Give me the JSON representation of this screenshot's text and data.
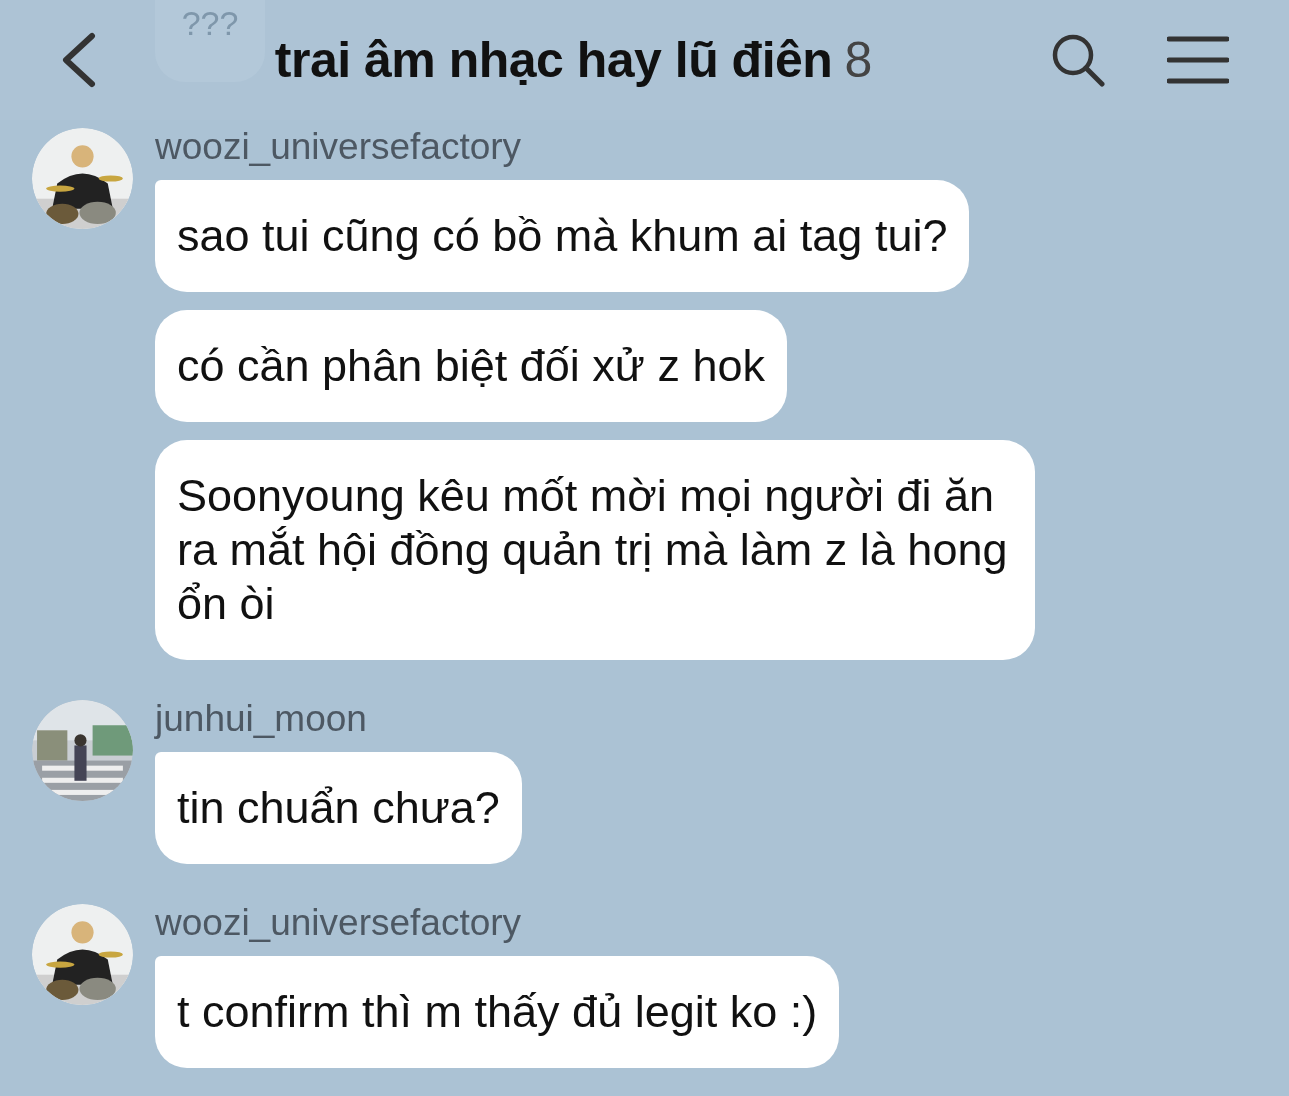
{
  "header": {
    "title": "trai âm nhạc hay lũ điên",
    "member_count": "8",
    "behind": {
      "text": "???"
    }
  },
  "groups": [
    {
      "sender": "woozi_universefactory",
      "messages": [
        "sao tui cũng có bồ mà khum ai tag tui?",
        "có cần phân biệt đối xử z hok",
        "Soonyoung kêu mốt mời mọi người đi ăn ra mắt hội đồng quản trị mà làm z là hong ổn òi"
      ]
    },
    {
      "sender": "junhui_moon",
      "messages": [
        "tin chuẩn chưa?"
      ]
    },
    {
      "sender": "woozi_universefactory",
      "messages": [
        "t confirm thì m thấy đủ legit ko :)"
      ]
    }
  ]
}
